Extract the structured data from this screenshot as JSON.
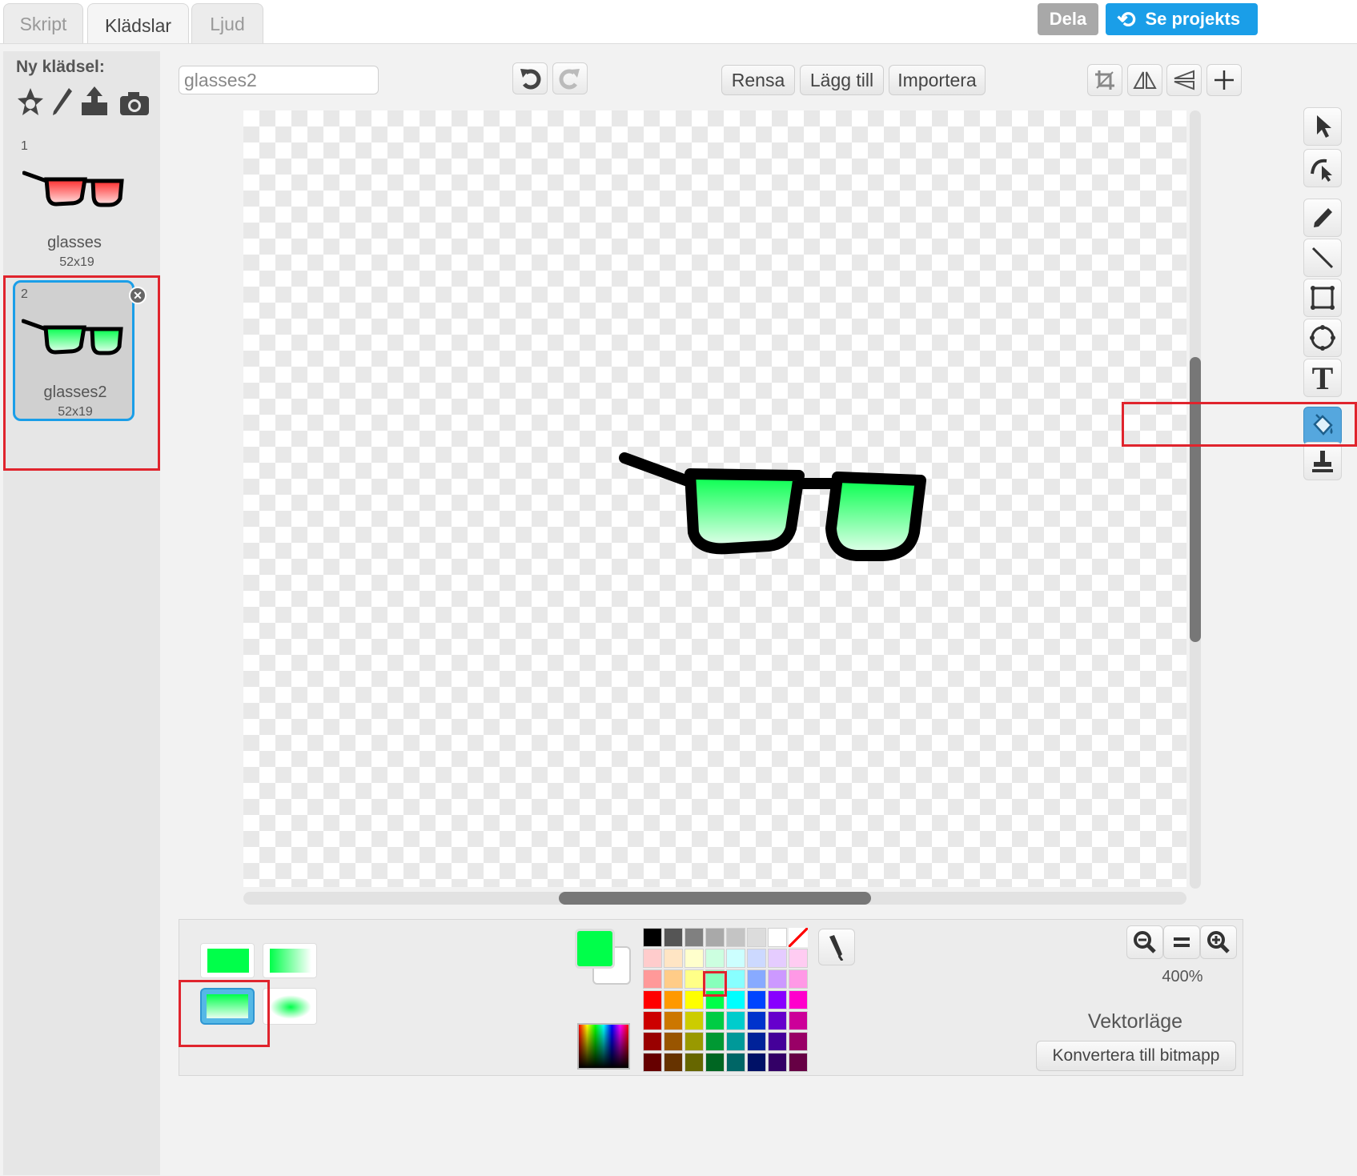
{
  "tabs": [
    {
      "label": "Skript"
    },
    {
      "label": "Klädslar"
    },
    {
      "label": "Ljud"
    }
  ],
  "header": {
    "share_label": "Dela",
    "see_project_label": "Se projekts"
  },
  "costumes_panel": {
    "new_costume_label": "Ny klädsel:",
    "items": [
      {
        "index": "1",
        "name": "glasses",
        "size": "52x19"
      },
      {
        "index": "2",
        "name": "glasses2",
        "size": "52x19"
      }
    ]
  },
  "editor": {
    "costume_name_value": "glasses2",
    "clear_label": "Rensa",
    "add_label": "Lägg till",
    "import_label": "Importera"
  },
  "bottom": {
    "zoom_level": "400%",
    "mode_label": "Vektorläge",
    "convert_label": "Konvertera till bitmapp",
    "primary_color": "#00ff4a"
  },
  "colors": {
    "accent_blue": "#1a9ee8",
    "highlight_red": "#e0242d",
    "selected_tool": "#55a7de"
  }
}
